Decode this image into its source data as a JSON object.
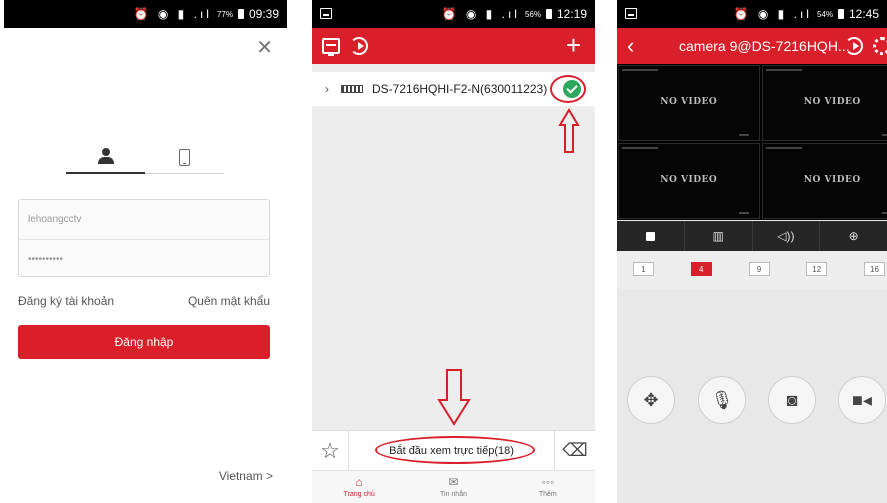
{
  "login_screen": {
    "status": {
      "pct": "77%",
      "time": "09:39"
    },
    "tabs": {
      "account_icon": "user-icon",
      "phone_icon": "phone-icon"
    },
    "username_value": "lehoangcctv",
    "password_value": "••••••••••",
    "register_label": "Đăng ký tài khoản",
    "forgot_label": "Quên mật khẩu",
    "login_button_label": "Đăng nhập",
    "region_label": "Vietnam >"
  },
  "device_screen": {
    "status": {
      "pct": "56%",
      "time": "12:19"
    },
    "device_name": "DS-7216HQHI-F2-N(630011223)",
    "live_view_label": "Bắt đầu xem trực tiếp(18)",
    "nav": [
      {
        "label": "Trang chủ",
        "glyph": "⌂"
      },
      {
        "label": "Tin nhắn",
        "glyph": "✉"
      },
      {
        "label": "Thêm",
        "glyph": "◦◦◦"
      }
    ]
  },
  "camera_screen": {
    "status": {
      "pct": "54%",
      "time": "12:45"
    },
    "title": "camera 9@DS-7216HQH...",
    "video_cells": [
      "NO VIDEO",
      "NO VIDEO",
      "NO VIDEO",
      "NO VIDEO"
    ],
    "pages": [
      "1",
      "4",
      "9",
      "12",
      "16"
    ],
    "active_page": "4"
  },
  "colors": {
    "accent": "#d9202a",
    "status_ok": "#2ba85c"
  }
}
